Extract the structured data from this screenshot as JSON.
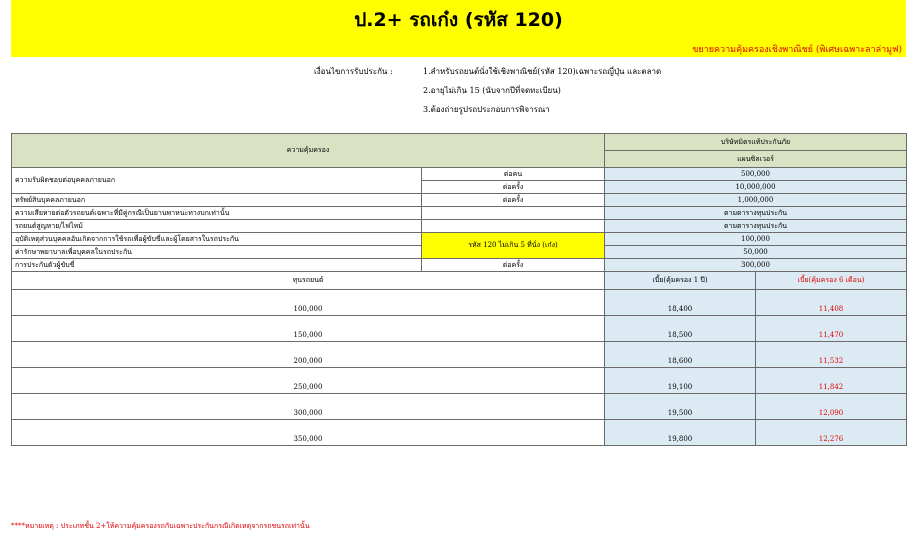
{
  "header": {
    "title": "ป.2+  รถเก๋ง (รหัส 120)",
    "subtitle": "ขยายความคุ้มครองเชิงพาณิชย์ (พิเศษเฉพาะลาล่ามูฟ)"
  },
  "conditions": {
    "label": "เงื่อนไขการรับประกัน :",
    "lines": [
      "1.สำหรับรถยนต์นั่งใช้เชิงพาณิชย์(รหัส 120)เฉพาะรถญี่ปุ่น และตลาด",
      "2.อายุไม่เกิน 15 (นับจากปีที่จดทะเบียน)",
      "3.ต้องถ่ายรูปรถประกอบการพิจารณา"
    ]
  },
  "table": {
    "coverage_header": "ความคุ้มครอง",
    "company_header": "บริษัทมิตรแท้ประกันภัย",
    "plan_header": "แผนซิลเวอร์",
    "rows": {
      "r1_label": "ความรับผิดชอบต่อบุคคลภายนอก",
      "r1_unit_a": "ต่อคน",
      "r1_value_a": "500,000",
      "r1_unit_b": "ต่อครั้ง",
      "r1_value_b": "10,000,000",
      "r2_label": "ทรัพย์สินบุคคลภายนอก",
      "r2_unit": "ต่อครั้ง",
      "r2_value": "1,000,000",
      "r3_label": "ความเสียหายต่อตัวรถยนต์เฉพาะที่มีคู่กรณีเป็นยานพาหนะทางบกเท่านั้น",
      "r3_value": "ตามตารางทุนประกัน",
      "r4_label": "รถยนต์สูญหาย/ไฟไหม้",
      "r4_value": "ตามตารางทุนประกัน",
      "r5_label": "อุบัติเหตุส่วนบุคคลอันเกิดจากการใช้รถเพื่อผู้ขับขี่และผู้โดยสารในรถประกัน",
      "r5_value": "100,000",
      "r6_label": "ค่ารักษาพยาบาลเพื่อบุคคลในรถประกัน",
      "r6_value": "50,000",
      "r56_note": "รหัส 120 ไม่เกิน 5 ที่นั่ง (เก๋ง)",
      "r7_label": "การประกันตัวผู้ขับขี่",
      "r7_unit": "ต่อครั้ง",
      "r7_value": "300,000"
    },
    "premium_header": {
      "sum_insured": "ทุนรถยนต์",
      "annual": "เบี้ย(คุ้มครอง 1 ปี)",
      "six_month": "เบี้ย(คุ้มครอง 6 เดือน)"
    },
    "premiums": [
      {
        "sum": "100,000",
        "annual": "18,400",
        "six": "11,408"
      },
      {
        "sum": "150,000",
        "annual": "18,500",
        "six": "11,470"
      },
      {
        "sum": "200,000",
        "annual": "18,600",
        "six": "11,532"
      },
      {
        "sum": "250,000",
        "annual": "19,100",
        "six": "11,842"
      },
      {
        "sum": "300,000",
        "annual": "19,500",
        "six": "12,090"
      },
      {
        "sum": "350,000",
        "annual": "19,800",
        "six": "12,276"
      }
    ]
  },
  "footnote": "****หมายเหตุ : ประเภทชั้น 2+ให้ความคุ้มครองรถกับเฉพาะประกันกรณีเกิดเหตุจากรถชนรถเท่านั้น"
}
